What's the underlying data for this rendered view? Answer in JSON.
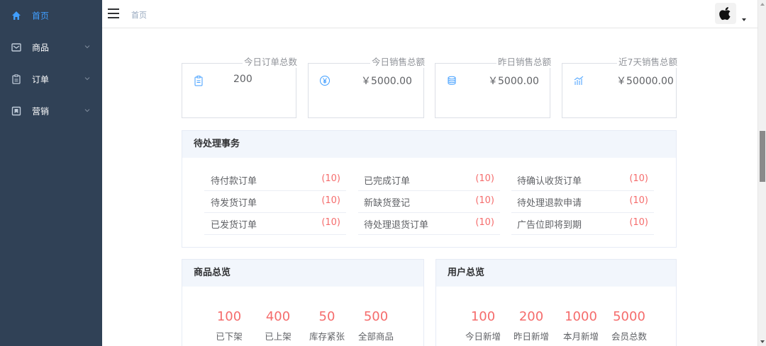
{
  "sidebar": {
    "items": [
      {
        "label": "首页",
        "icon": "home-icon",
        "active": true,
        "has_arrow": false
      },
      {
        "label": "商品",
        "icon": "product-icon",
        "active": false,
        "has_arrow": true
      },
      {
        "label": "订单",
        "icon": "order-icon",
        "active": false,
        "has_arrow": true
      },
      {
        "label": "营销",
        "icon": "marketing-icon",
        "active": false,
        "has_arrow": true
      }
    ]
  },
  "header": {
    "breadcrumb": "首页",
    "avatar_icon": "apple-icon"
  },
  "stats": [
    {
      "title": "今日订单总数",
      "value": "200",
      "icon": "clipboard-icon"
    },
    {
      "title": "今日销售总额",
      "value": "￥5000.00",
      "icon": "yuan-coin-icon"
    },
    {
      "title": "昨日销售总额",
      "value": "￥5000.00",
      "icon": "coin-stack-icon"
    },
    {
      "title": "近7天销售总额",
      "value": "￥50000.00",
      "icon": "trend-chart-icon"
    }
  ],
  "todo": {
    "title": "待处理事务",
    "columns": [
      [
        {
          "label": "待付款订单",
          "count": "(10)"
        },
        {
          "label": "待发货订单",
          "count": "(10)"
        },
        {
          "label": "已发货订单",
          "count": "(10)"
        }
      ],
      [
        {
          "label": "已完成订单",
          "count": "(10)"
        },
        {
          "label": "新缺货登记",
          "count": "(10)"
        },
        {
          "label": "待处理退货订单",
          "count": "(10)"
        }
      ],
      [
        {
          "label": "待确认收货订单",
          "count": "(10)"
        },
        {
          "label": "待处理退款申请",
          "count": "(10)"
        },
        {
          "label": "广告位即将到期",
          "count": "(10)"
        }
      ]
    ]
  },
  "product_overview": {
    "title": "商品总览",
    "items": [
      {
        "value": "100",
        "label": "已下架"
      },
      {
        "value": "400",
        "label": "已上架"
      },
      {
        "value": "50",
        "label": "库存紧张"
      },
      {
        "value": "500",
        "label": "全部商品"
      }
    ]
  },
  "user_overview": {
    "title": "用户总览",
    "items": [
      {
        "value": "100",
        "label": "今日新增"
      },
      {
        "value": "200",
        "label": "昨日新增"
      },
      {
        "value": "1000",
        "label": "本月新增"
      },
      {
        "value": "5000",
        "label": "会员总数"
      }
    ]
  },
  "colors": {
    "sidebar_bg": "#304156",
    "active": "#409eff",
    "count_red": "#f56c6c",
    "panel_head_bg": "#f2f6fc"
  }
}
